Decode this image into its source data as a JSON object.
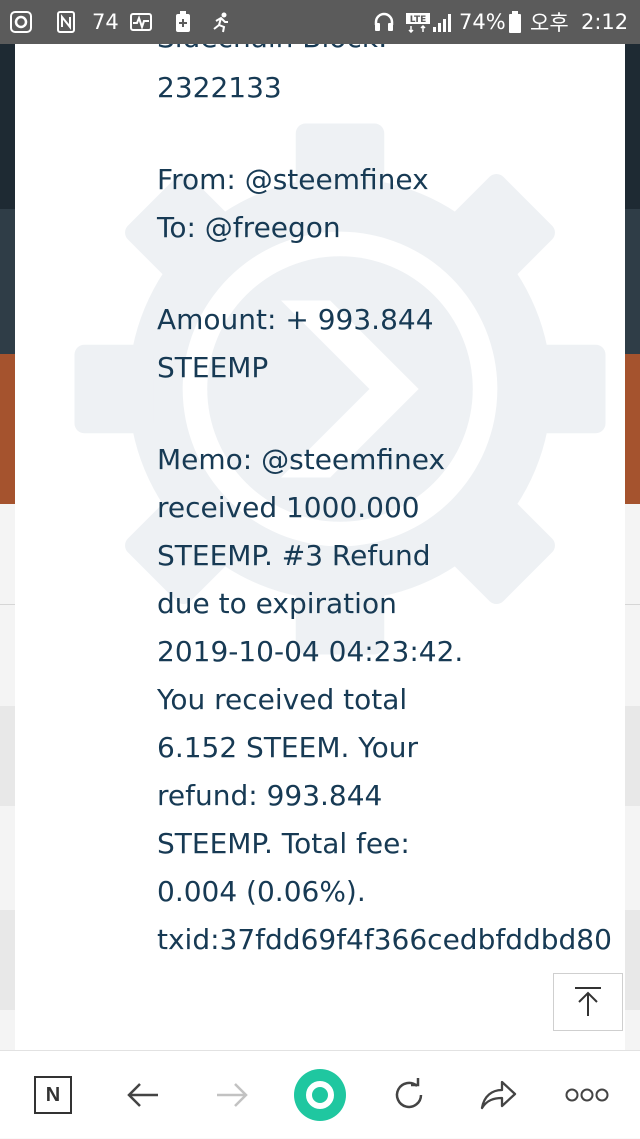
{
  "status_bar": {
    "notification_count": "74",
    "battery_percent": "74%",
    "time_period": "오후",
    "time": "2:12",
    "icons": [
      "settings-ring-icon",
      "n-app-icon",
      "pulse-icon",
      "battery-plus-icon",
      "running-icon",
      "headset-icon",
      "lte-icon",
      "signal-icon",
      "battery-icon"
    ]
  },
  "memo_card": {
    "block_label_partial": "Sidechain Block:",
    "block_number": "2322133",
    "from_line": "From: @steemfinex",
    "to_line": "To: @freegon",
    "amount_line1": "Amount: + 993.844",
    "amount_line2": "STEEMP",
    "memo_lines": [
      "Memo: @steemfinex",
      "received 1000.000",
      "STEEMP. #3 Refund",
      "due to expiration",
      "2019-10-04 04:23:42.",
      "You received total",
      "6.152 STEEM. Your",
      "refund: 993.844",
      "STEEMP. Total fee:",
      "0.004 (0.06%).",
      "txid:37fdd69f4f366cedbfddbd80"
    ],
    "watermark_icon": "steem-engine-gear-icon",
    "text_color": "#173a54"
  },
  "scroll_top_button": {
    "icon": "arrow-up-to-top-icon"
  },
  "nav_bar": {
    "home_label": "N",
    "items": [
      "n-home-icon",
      "back-arrow-icon",
      "forward-arrow-icon",
      "green-circle-icon",
      "reload-icon",
      "share-icon",
      "more-dots-icon"
    ],
    "accent_color": "#1fc7a0"
  }
}
